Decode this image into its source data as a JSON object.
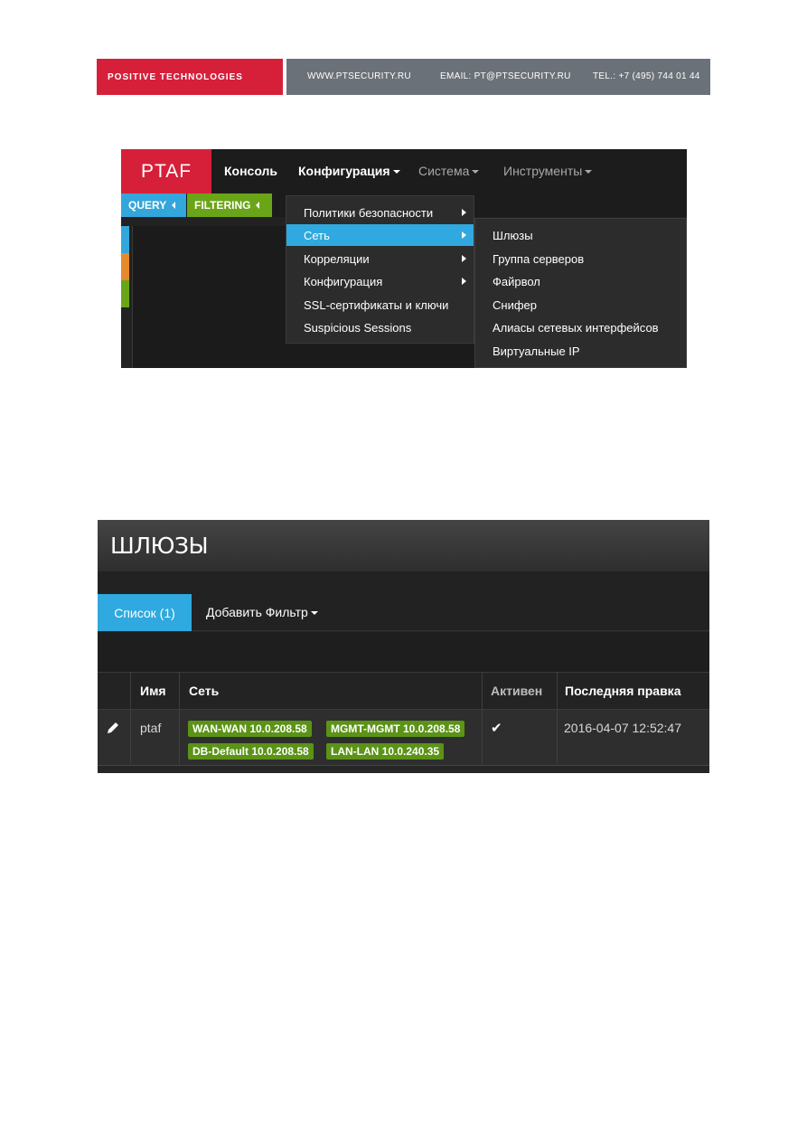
{
  "banner": {
    "company": "POSITIVE TECHNOLOGIES",
    "website": "WWW.PTSECURITY.RU",
    "email": "EMAIL: PT@PTSECURITY.RU",
    "phone": "TEL.: +7 (495) 744 01 44"
  },
  "menu_screenshot": {
    "logo": "PTAF",
    "nav": [
      "Консоль",
      "Конфигурация",
      "Система",
      "Инструменты"
    ],
    "subnav": [
      "QUERY",
      "FILTERING"
    ],
    "config_menu": [
      {
        "label": "Политики безопасности",
        "submenu": true
      },
      {
        "label": "Сеть",
        "submenu": true,
        "active": true
      },
      {
        "label": "Корреляции",
        "submenu": true
      },
      {
        "label": "Конфигурация",
        "submenu": true
      },
      {
        "label": "SSL-сертификаты и ключи",
        "submenu": false
      },
      {
        "label": "Suspicious Sessions",
        "submenu": false
      }
    ],
    "network_menu": [
      "Шлюзы",
      "Группа серверов",
      "Файрвол",
      "Снифер",
      "Алиасы сетевых интерфейсов",
      "Виртуальные IP"
    ]
  },
  "gateways_screenshot": {
    "title": "ШЛЮЗЫ",
    "tab_list": "Список (1)",
    "tab_filter": "Добавить Фильтр",
    "columns": [
      "Имя",
      "Сеть",
      "Активен",
      "Последняя правка"
    ],
    "row": {
      "name": "ptaf",
      "networks": [
        "WAN-WAN 10.0.208.58",
        "MGMT-MGMT 10.0.208.58",
        "DB-Default 10.0.208.58",
        "LAN-LAN 10.0.240.35"
      ],
      "active": "✔",
      "last_edit": "2016-04-07 12:52:47"
    }
  },
  "colors": {
    "brand_red": "#d6203a",
    "accent_blue": "#2fa9df",
    "tag_green": "#5b9317",
    "filter_green": "#6aa517"
  }
}
